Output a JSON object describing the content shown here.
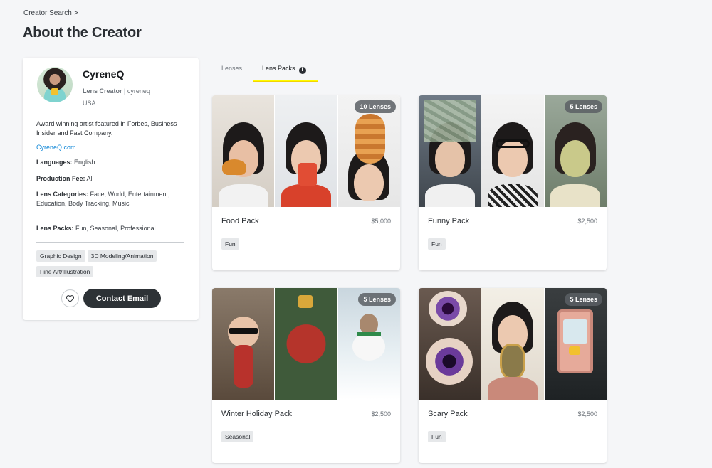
{
  "breadcrumb": "Creator Search >",
  "page_title": "About the Creator",
  "profile": {
    "name": "CyreneQ",
    "role": "Lens Creator",
    "handle": " | cyreneq",
    "country": "USA",
    "bio": "Award winning artist featured in Forbes, Business Insider and Fast Company.",
    "website": "CyreneQ.com",
    "languages_label": "Languages:",
    "languages": " English",
    "fee_label": "Production Fee:",
    "fee": " All",
    "categories_label": "Lens Categories:",
    "categories": " Face, World, Entertainment, Education, Body Tracking, Music",
    "packs_label": "Lens Packs:",
    "packs": " Fun, Seasonal, Professional",
    "skills": [
      "Graphic Design",
      "3D Modeling/Animation",
      "Fine Art/Illustration"
    ],
    "contact_label": "Contact Email",
    "heart_icon": "heart-icon"
  },
  "tabs": {
    "lenses": "Lenses",
    "lens_packs": "Lens Packs",
    "info_glyph": "i"
  },
  "packs": [
    {
      "name": "Food Pack",
      "price": "$5,000",
      "tag": "Fun",
      "count": "10 Lenses"
    },
    {
      "name": "Funny Pack",
      "price": "$2,500",
      "tag": "Fun",
      "count": "5 Lenses"
    },
    {
      "name": "Winter Holiday Pack",
      "price": "$2,500",
      "tag": "Seasonal",
      "count": "5 Lenses"
    },
    {
      "name": "Scary Pack",
      "price": "$2,500",
      "tag": "Fun",
      "count": "5 Lenses"
    }
  ],
  "colors": {
    "accent_yellow": "#fffc00",
    "link_blue": "#0a84d6",
    "button_dark": "#2d3236"
  }
}
